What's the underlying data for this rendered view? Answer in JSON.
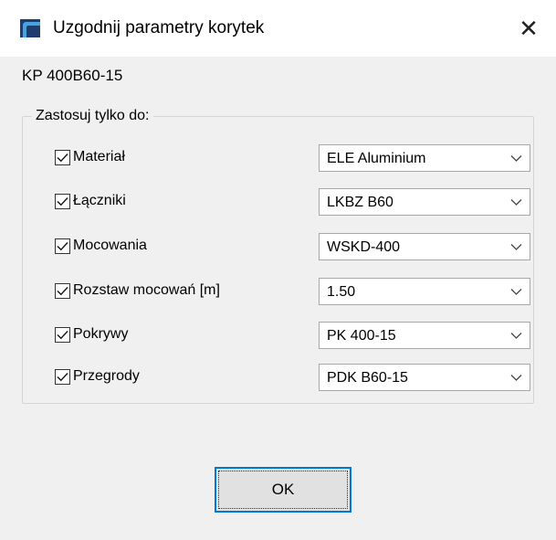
{
  "window": {
    "title": "Uzgodnij parametry korytek",
    "close_glyph": "✕",
    "icon": "corner-tray-icon",
    "accent": "#0078d7"
  },
  "product_code": "KP 400B60-15",
  "group": {
    "legend": "Zastosuj tylko do:",
    "rows": [
      {
        "label": "Materiał",
        "checked": true,
        "value": "ELE Aluminium"
      },
      {
        "label": "Łączniki",
        "checked": true,
        "value": "LKBZ B60"
      },
      {
        "label": "Mocowania",
        "checked": true,
        "value": "WSKD-400"
      },
      {
        "label": "Rozstaw mocowań [m]",
        "checked": true,
        "value": "1.50"
      },
      {
        "label": "Pokrywy",
        "checked": true,
        "value": "PK 400-15"
      },
      {
        "label": "Przegrody",
        "checked": true,
        "value": "PDK B60-15"
      }
    ]
  },
  "buttons": {
    "ok_label": "OK"
  }
}
